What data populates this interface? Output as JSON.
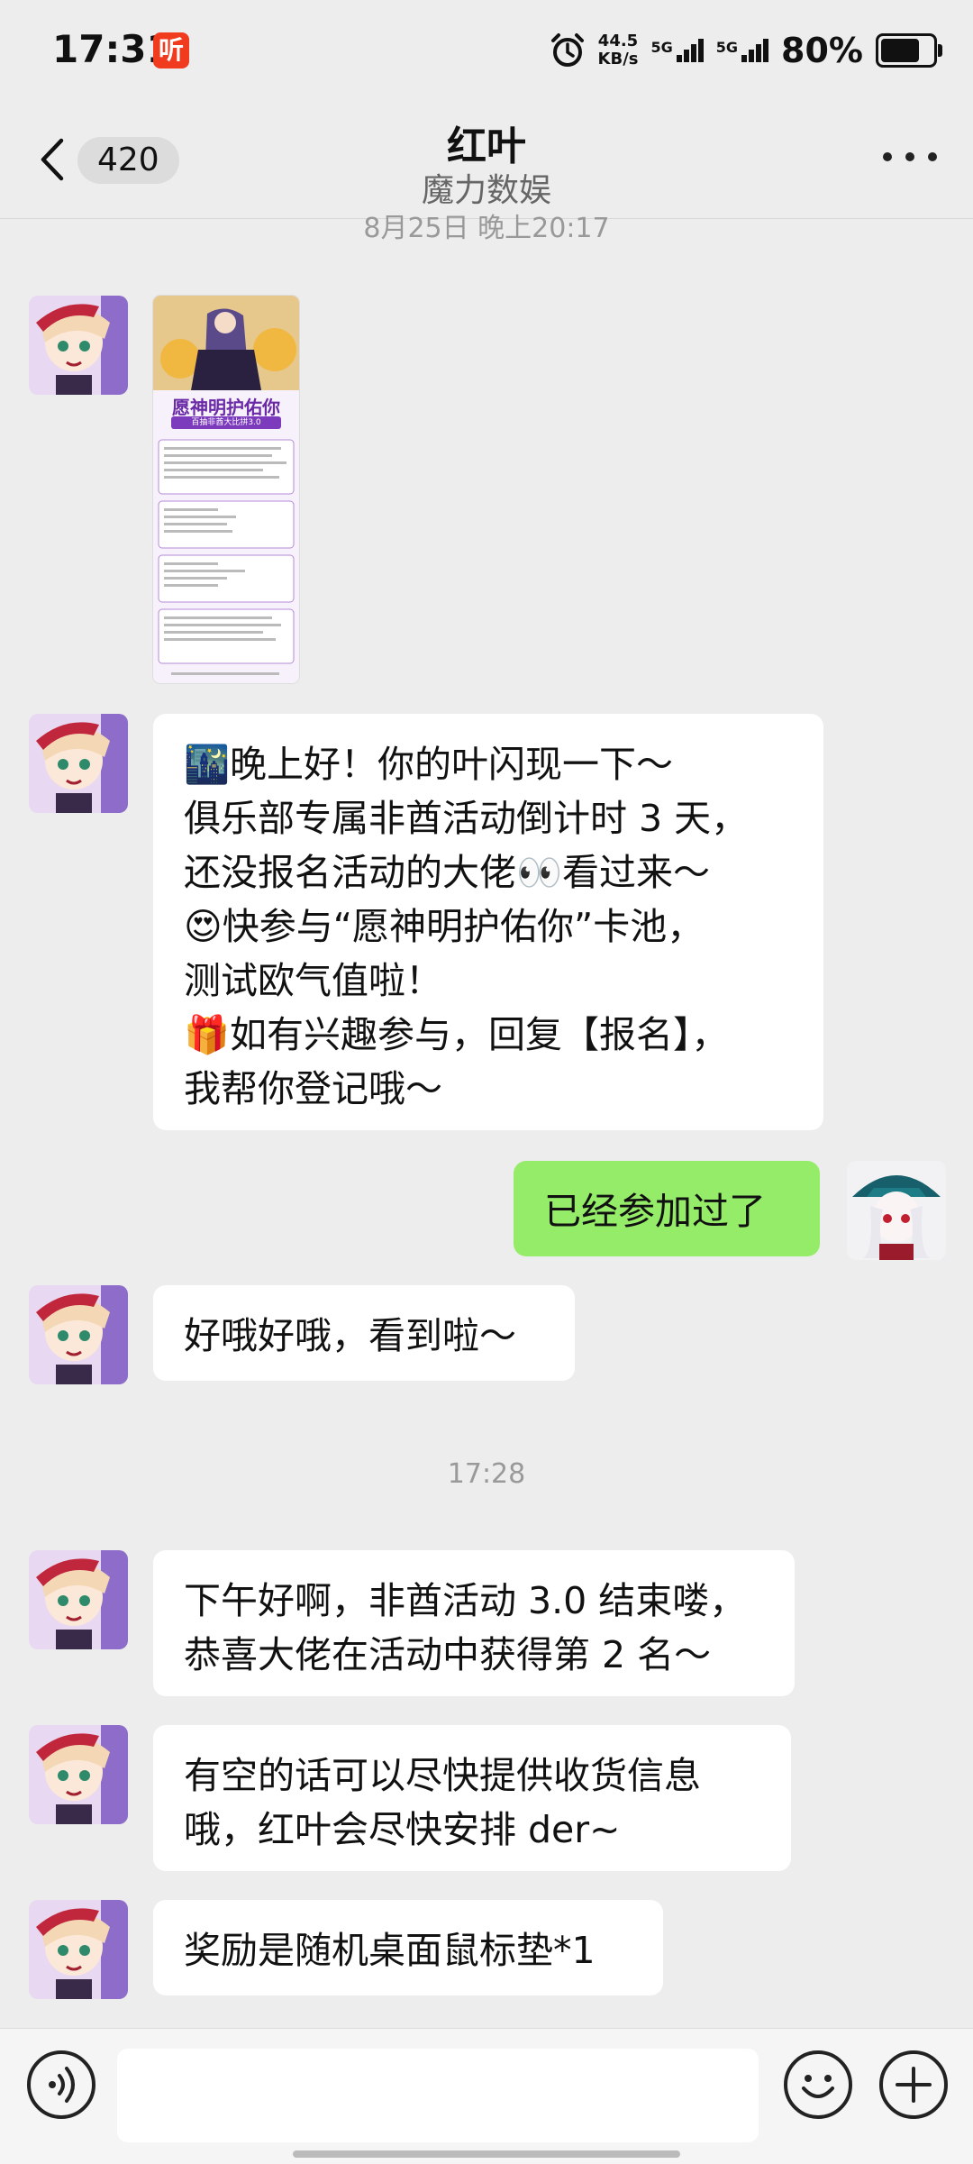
{
  "status_bar": {
    "time": "17:31",
    "notification_badge": "听",
    "net_speed_value": "44.5",
    "net_speed_unit": "KB/s",
    "sim1_label": "5G",
    "sim2_label": "5G",
    "battery_percent": "80%",
    "battery_level": 0.8
  },
  "header": {
    "unread_count": "420",
    "title": "红叶",
    "subtitle": "魔力数娱"
  },
  "chat": {
    "timestamp_top": "8月25日 晚上20:17",
    "image_message": {
      "poster_title": "愿神明护佑你",
      "poster_subtitle": "百抽非酋大比拼3.0"
    },
    "message_1": {
      "lines": [
        "🌃晚上好！你的叶闪现一下～",
        "俱乐部专属非酋活动倒计时 3 天，",
        "还没报名活动的大佬👀看过来～",
        "😍快参与“愿神明护佑你”卡池，",
        "测试欧气值啦！",
        "🎁如有兴趣参与，回复【报名】，",
        "我帮你登记哦～"
      ]
    },
    "message_2_me": "已经参加过了",
    "message_3": "好哦好哦，看到啦～",
    "timestamp_2": "17:28",
    "message_4": {
      "lines": [
        "下午好啊，非酋活动 3.0 结束喽，",
        "恭喜大佬在活动中获得第 2 名～"
      ]
    },
    "message_5": {
      "lines": [
        "有空的话可以尽快提供收货信息",
        "哦，红叶会尽快安排 der~"
      ]
    },
    "message_6": "奖励是随机桌面鼠标垫*1"
  },
  "input_bar": {
    "placeholder": ""
  },
  "icons": {
    "back": "chevron-left-icon",
    "more": "more-dots-icon",
    "voice": "voice-icon",
    "emoji": "emoji-icon",
    "plus": "plus-icon",
    "alarm": "alarm-icon"
  },
  "colors": {
    "background": "#ededed",
    "incoming_bubble": "#ffffff",
    "outgoing_bubble": "#95ec69",
    "notification": "#f03b1f"
  }
}
